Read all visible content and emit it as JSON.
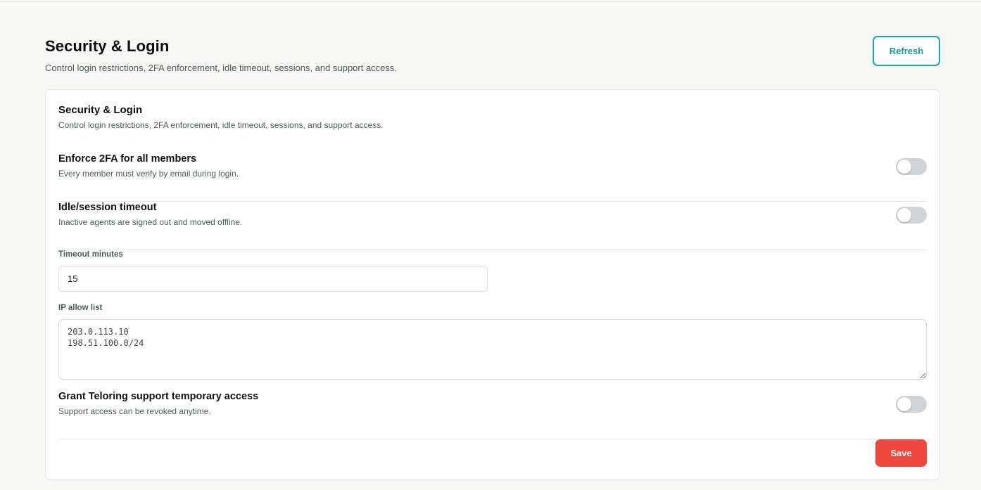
{
  "header": {
    "title": "Security & Login",
    "subtitle": "Control login restrictions, 2FA enforcement, idle timeout, sessions, and support access.",
    "refresh_label": "Refresh"
  },
  "card": {
    "title": "Security & Login",
    "subtitle": "Control login restrictions, 2FA enforcement, idle timeout, sessions, and support access."
  },
  "settings": {
    "enforce_2fa": {
      "label": "Enforce 2FA for all members",
      "description": "Every member must verify by email during login.",
      "enabled": false
    },
    "idle_timeout": {
      "label": "Idle/session timeout",
      "description": "Inactive agents are signed out and moved offline.",
      "enabled": false
    },
    "support_access": {
      "label": "Grant Teloring support temporary access",
      "description": "Support access can be revoked anytime.",
      "enabled": false
    }
  },
  "fields": {
    "timeout_minutes": {
      "label": "Timeout minutes",
      "value": "15"
    },
    "ip_allow_list": {
      "label": "IP allow list",
      "value": "203.0.113.10\n198.51.100.0/24"
    }
  },
  "footer": {
    "save_label": "Save"
  },
  "colors": {
    "accent_teal": "#19a99a",
    "save_red": "#f0473d",
    "toggle_off": "#cfd4d8"
  }
}
